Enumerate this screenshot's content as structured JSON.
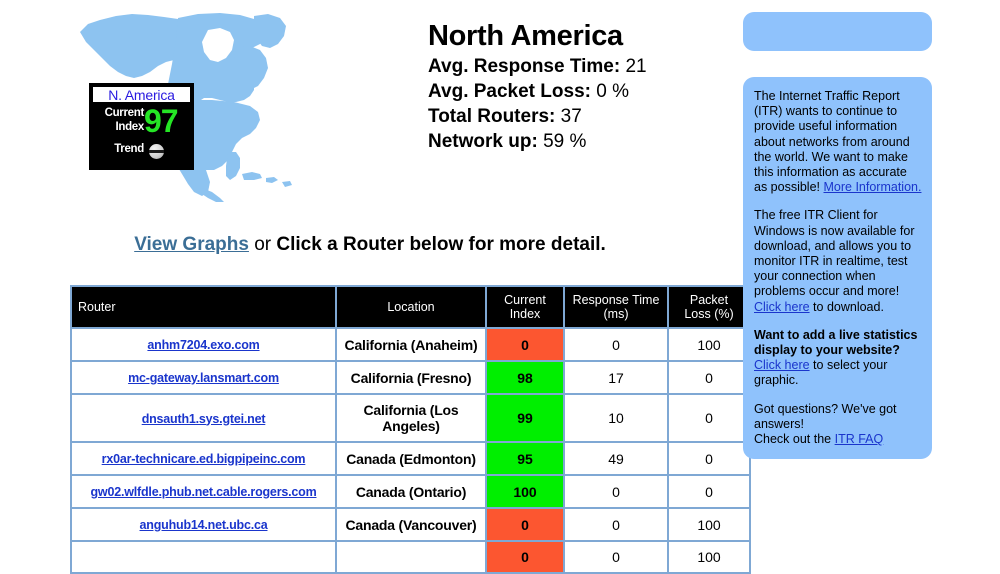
{
  "region": {
    "map_alt": "north-america-map",
    "badge": {
      "title": "N. America",
      "label_line1": "Current",
      "label_line2": "Index",
      "value": "97",
      "trend_label": "Trend",
      "trend_state": "steady",
      "value_color": "#25e625",
      "title_color": "#2a1ae0"
    }
  },
  "header": {
    "title": "North America",
    "stats": [
      {
        "label": "Avg. Response Time:",
        "value": "21"
      },
      {
        "label": "Avg. Packet Loss:",
        "value": "0 %"
      },
      {
        "label": "Total Routers:",
        "value": "37"
      },
      {
        "label": "Network up:",
        "value": "59 %"
      }
    ]
  },
  "instruction": {
    "link": "View Graphs",
    "middle": " or ",
    "rest": "Click a Router below for more detail."
  },
  "table": {
    "columns": [
      "Router",
      "Location",
      "Current Index",
      "Response Time (ms)",
      "Packet Loss (%)"
    ],
    "columns_multiline": [
      {
        "line1": "Router",
        "line2": ""
      },
      {
        "line1": "Location",
        "line2": ""
      },
      {
        "line1": "Current",
        "line2": "Index"
      },
      {
        "line1": "Response Time",
        "line2": "(ms)"
      },
      {
        "line1": "Packet",
        "line2": "Loss (%)"
      }
    ],
    "rows": [
      {
        "router": "anhm7204.exo.com",
        "location": "California (Anaheim)",
        "index": "0",
        "index_color": "#fc5630",
        "response_time": "0",
        "packet_loss": "100"
      },
      {
        "router": "mc-gateway.lansmart.com",
        "location": "California (Fresno)",
        "index": "98",
        "index_color": "#00ef00",
        "response_time": "17",
        "packet_loss": "0"
      },
      {
        "router": "dnsauth1.sys.gtei.net",
        "location": "California (Los Angeles)",
        "index": "99",
        "index_color": "#00ef00",
        "response_time": "10",
        "packet_loss": "0"
      },
      {
        "router": "rx0ar-technicare.ed.bigpipeinc.com",
        "location": "Canada (Edmonton)",
        "index": "95",
        "index_color": "#00ef00",
        "response_time": "49",
        "packet_loss": "0"
      },
      {
        "router": "gw02.wlfdle.phub.net.cable.rogers.com",
        "location": "Canada (Ontario)",
        "index": "100",
        "index_color": "#00ef00",
        "response_time": "0",
        "packet_loss": "0"
      },
      {
        "router": "anguhub14.net.ubc.ca",
        "location": "Canada (Vancouver)",
        "index": "0",
        "index_color": "#fc5630",
        "response_time": "0",
        "packet_loss": "100"
      },
      {
        "router": "",
        "location": "",
        "index": "0",
        "index_color": "#fc5630",
        "response_time": "0",
        "packet_loss": "100"
      }
    ]
  },
  "sidebar": {
    "banner_empty": "",
    "blocks": [
      {
        "id": "itr-mission",
        "text_before": "The Internet Traffic Report (ITR) wants to continue to provide useful information about networks from around the world. We want to make this information as accurate as possible!",
        "link": "More Information.",
        "text_after": ""
      },
      {
        "id": "itr-client",
        "text_before": "The free ITR Client for Windows is now available for download, and allows you to monitor ITR in realtime, test your connection when problems occur and more!",
        "link": "Click here",
        "text_after": " to download."
      },
      {
        "id": "itr-stats-display",
        "bold_text": "Want to add a live statistics display to your website?",
        "link": "Click here",
        "text_after": " to select your graphic."
      },
      {
        "id": "itr-faq",
        "text_before": "Got questions? We've got answers!",
        "text_line2": "Check out the ",
        "link": "ITR FAQ",
        "text_after": ""
      }
    ]
  },
  "colors": {
    "panel_blue": "#8fc2fc",
    "map_blue": "#8dc3f0",
    "table_border": "#7fa8d4",
    "link_blue": "#1a35cc",
    "graph_link": "#3b6e96",
    "good_green": "#00ef00",
    "bad_orange": "#fc5630"
  }
}
